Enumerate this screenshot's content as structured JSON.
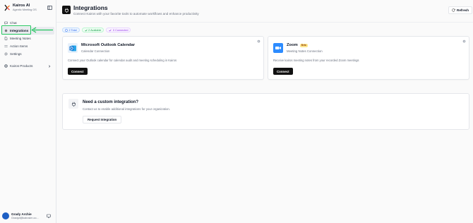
{
  "app": {
    "name": "Kairos AI",
    "subtitle": "Agentic Meeting OS"
  },
  "sidebar": {
    "items": [
      {
        "label": "Chat",
        "icon": "chat-icon"
      },
      {
        "label": "Integrations",
        "icon": "settings-icon",
        "active": true
      },
      {
        "label": "Meeting Notes",
        "icon": "document-icon"
      },
      {
        "label": "Action Items",
        "icon": "checklist-icon"
      },
      {
        "label": "Settings",
        "icon": "gear-icon"
      }
    ],
    "products": {
      "label": "Kairos Products",
      "icon": "globe-icon"
    }
  },
  "user": {
    "name": "Grady Archie",
    "email": "Gradyd@kairosim.co..."
  },
  "header": {
    "title": "Integrations",
    "subtitle": "Connect Kairos with your favorite tools to automate workflows and enhance productivity",
    "refresh_label": "Refresh"
  },
  "badges": {
    "total": "2 Total",
    "available": "2 Available",
    "connected": "0 Connected"
  },
  "integrations": [
    {
      "name": "Microsoft Outlook Calendar",
      "category": "Calendar Connection",
      "description": "Connect your Outlook calendar for calendar audit and meeting scheduling in Kairos",
      "button": "Connect",
      "icon": "outlook-icon"
    },
    {
      "name": "Zoom",
      "badge": "Beta",
      "category": "Meeting Notes Connection",
      "description": "Receive kairos meeting notes from your recorded Zoom meetings",
      "button": "Connect",
      "icon": "zoom-icon"
    }
  ],
  "custom": {
    "title": "Need a custom integration?",
    "subtitle": "Contact us to enable additional integrations for your organization.",
    "button": "Request Integration"
  },
  "colors": {
    "highlight": "#22c55e",
    "primary": "#111111",
    "outlook": "#0a6ed1",
    "zoom": "#2d8cff"
  }
}
